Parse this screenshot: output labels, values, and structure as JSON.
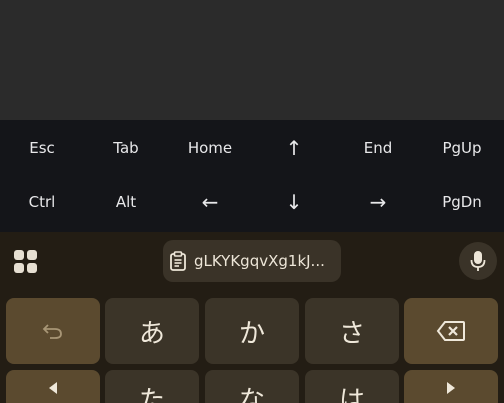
{
  "extra_keys": {
    "row1": [
      "Esc",
      "Tab",
      "Home",
      "↑",
      "End",
      "PgUp"
    ],
    "row2": [
      "Ctrl",
      "Alt",
      "←",
      "↓",
      "→",
      "PgDn"
    ]
  },
  "toolbar": {
    "clipboard_text": "gLKYKgqvXg1kJ..."
  },
  "keyboard": {
    "row1": [
      "あ",
      "か",
      "さ"
    ],
    "row2": [
      "た",
      "な",
      "は"
    ]
  },
  "icons": {
    "grid": "grid-icon",
    "clipboard": "clipboard-icon",
    "mic": "mic-icon",
    "undo": "undo-icon",
    "backspace": "backspace-icon",
    "left": "arrow-left-icon",
    "right": "arrow-right-icon"
  },
  "colors": {
    "extra_keys_bg": "#141519",
    "keyboard_bg": "#231d14",
    "key_bg": "#3b3428",
    "function_key_bg": "#5b4a2f"
  }
}
